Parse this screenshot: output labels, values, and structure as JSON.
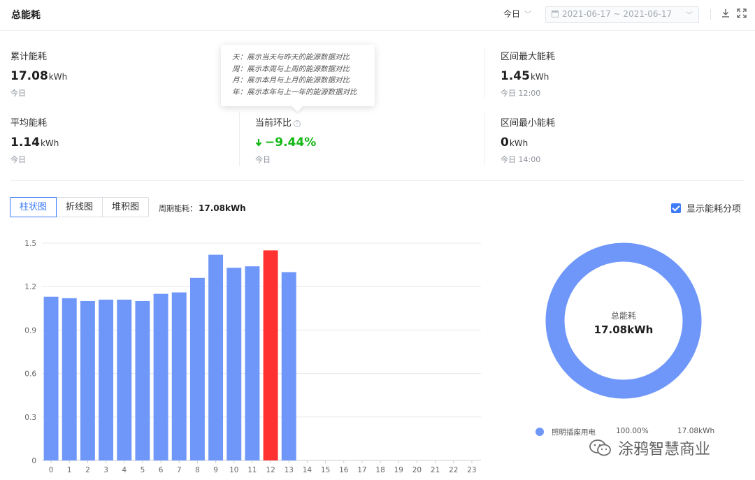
{
  "header": {
    "title": "总能耗",
    "period": "今日",
    "date_range": "2021-06-17 ~ 2021-06-17"
  },
  "stats": {
    "cumulative": {
      "label": "累计能耗",
      "value": "17.08",
      "unit": "kWh",
      "sub": "今日"
    },
    "max": {
      "label": "区间最大能耗",
      "value": "1.45",
      "unit": "kWh",
      "sub": "今日 12:00"
    },
    "average": {
      "label": "平均能耗",
      "value": "1.14",
      "unit": "kWh",
      "sub": "今日"
    },
    "change": {
      "label": "当前环比",
      "value": "−9.44%",
      "sub": "今日"
    },
    "min": {
      "label": "区间最小能耗",
      "value": "0",
      "unit": "kWh",
      "sub": "今日 14:00"
    }
  },
  "tooltip": {
    "lines": [
      "天：展示当天与昨天的能源数据对比",
      "周：展示本周与上周的能源数据对比",
      "月：展示本月与上月的能源数据对比",
      "年：展示本年与上一年的能源数据对比"
    ]
  },
  "toolbar": {
    "tabs": [
      {
        "label": "柱状图",
        "active": true
      },
      {
        "label": "折线图",
        "active": false
      },
      {
        "label": "堆积图",
        "active": false
      }
    ],
    "period_total_label": "周期能耗：",
    "period_total_value": "17.08kWh",
    "show_items_label": "显示能耗分项",
    "show_items_checked": true
  },
  "chart_data": [
    {
      "type": "bar",
      "categories": [
        "0",
        "1",
        "2",
        "3",
        "4",
        "5",
        "6",
        "7",
        "8",
        "9",
        "10",
        "11",
        "12",
        "13",
        "14",
        "15",
        "16",
        "17",
        "18",
        "19",
        "20",
        "21",
        "22",
        "23"
      ],
      "values": [
        1.13,
        1.12,
        1.1,
        1.11,
        1.11,
        1.1,
        1.15,
        1.16,
        1.26,
        1.42,
        1.33,
        1.34,
        1.45,
        1.3,
        null,
        null,
        null,
        null,
        null,
        null,
        null,
        null,
        null,
        null
      ],
      "highlight_index": 12,
      "ylim": [
        0,
        1.5
      ],
      "yticks": [
        "0",
        "0.3",
        "0.6",
        "0.9",
        "1.2",
        "1.5"
      ],
      "grid": true,
      "colors": {
        "bar": "#6f97fa",
        "highlight": "#ff3131"
      }
    },
    {
      "type": "pie",
      "center_label": "总能耗",
      "center_value": "17.08kWh",
      "slices": [
        {
          "name": "照明插座用电",
          "percent": "100.00%",
          "value": "17.08kWh"
        }
      ],
      "colors": {
        "slice": "#6f97fa"
      }
    }
  ],
  "watermark": {
    "text": "涂鸦智慧商业"
  }
}
